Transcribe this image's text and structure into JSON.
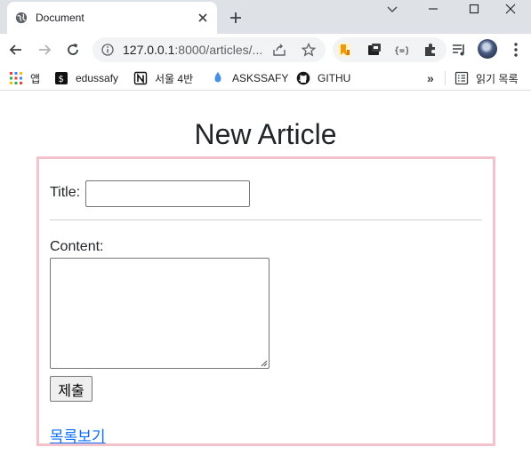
{
  "tab": {
    "title": "Document"
  },
  "address_bar": {
    "host": "127.0.0.1",
    "path": ":8000/articles/..."
  },
  "bookmarks": [
    {
      "label": "앱",
      "icon": "apps-grid-icon"
    },
    {
      "label": "edussafy",
      "icon": "edussafy-icon"
    },
    {
      "label": "서울 4반",
      "icon": "notion-icon"
    },
    {
      "label": "ASKSSAFY",
      "icon": "pin-icon"
    },
    {
      "label": "GITHU",
      "icon": "github-icon"
    }
  ],
  "bookmarks_more": "»",
  "reading_list": {
    "label": "읽기 목록",
    "icon": "reading-list-icon"
  },
  "page": {
    "heading": "New Article",
    "title_label": "Title:",
    "title_value": "",
    "content_label": "Content:",
    "content_value": "",
    "submit_label": "제출",
    "list_link": "목록보기"
  },
  "colors": {
    "form_border": "#f4c2cb",
    "link": "#0d6efd",
    "tabstrip": "#dee1e6"
  }
}
